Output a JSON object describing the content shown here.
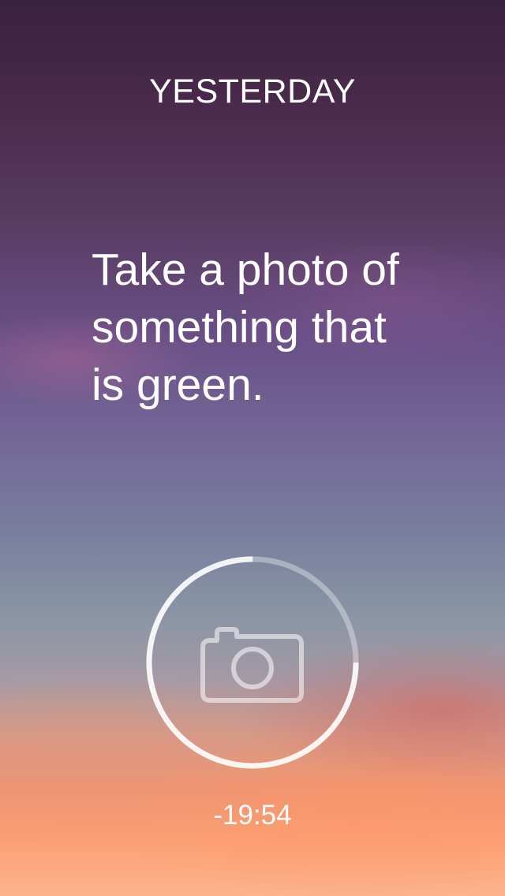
{
  "header": {
    "title": "YESTERDAY"
  },
  "challenge": {
    "prompt": "Take a photo of\nsomething that\nis green."
  },
  "capture": {
    "icon": "camera-icon",
    "progress_fraction": 0.75,
    "ring_color": "#ffffff"
  },
  "timer": {
    "remaining": "-19:54"
  }
}
